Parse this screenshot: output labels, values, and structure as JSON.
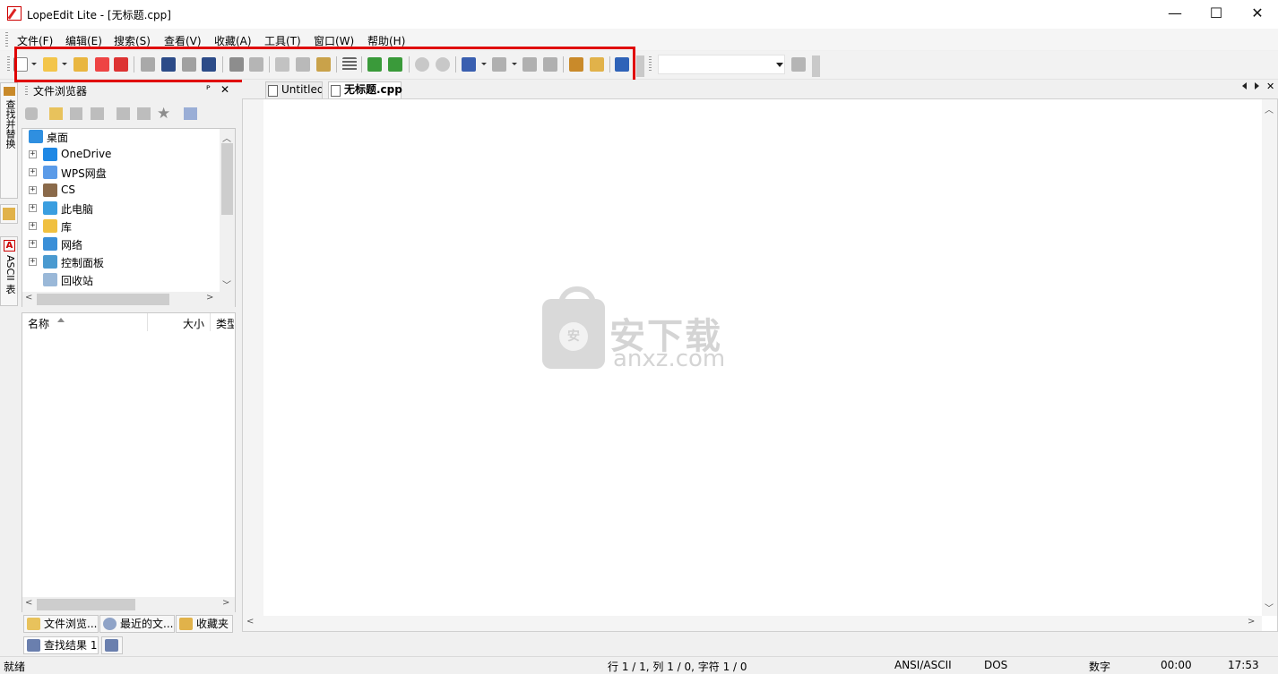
{
  "window": {
    "title": "LopeEdit Lite - [无标题.cpp]",
    "minimize_glyph": "—",
    "maximize_glyph": "☐",
    "close_glyph": "✕"
  },
  "menu": [
    "文件(F)",
    "编辑(E)",
    "搜索(S)",
    "查看(V)",
    "收藏(A)",
    "工具(T)",
    "窗口(W)",
    "帮助(H)"
  ],
  "toolbar": {
    "buttons": [
      "new-file",
      "open-file",
      "open-folder",
      "close-file",
      "close-all",
      "save-disabled",
      "save-as",
      "save-all",
      "save-copy",
      "print",
      "print-preview",
      "cut",
      "copy",
      "paste",
      "align",
      "indent",
      "outdent",
      "undo",
      "redo",
      "find",
      "find-next",
      "find-prev",
      "replace",
      "favorite",
      "favorite-manage",
      "run"
    ],
    "highlight_color": "#e00000",
    "combo_value": ""
  },
  "side_tabs": [
    "查找并替换",
    "ASCII 表"
  ],
  "file_browser": {
    "title": "文件浏览器",
    "pin_glyph": "ᴾ",
    "close_glyph": "✕",
    "tree": [
      {
        "label": "桌面",
        "icon": "desktop-icon",
        "expand": ""
      },
      {
        "label": "OneDrive",
        "icon": "onedrive-icon",
        "expand": "+"
      },
      {
        "label": "WPS网盘",
        "icon": "cloud-icon",
        "expand": "+"
      },
      {
        "label": "CS",
        "icon": "user-icon",
        "expand": "+"
      },
      {
        "label": "此电脑",
        "icon": "computer-icon",
        "expand": "+"
      },
      {
        "label": "库",
        "icon": "library-icon",
        "expand": "+"
      },
      {
        "label": "网络",
        "icon": "network-icon",
        "expand": "+"
      },
      {
        "label": "控制面板",
        "icon": "control-panel-icon",
        "expand": "+"
      },
      {
        "label": "回收站",
        "icon": "recycle-bin-icon",
        "expand": ""
      }
    ],
    "columns": {
      "name": "名称",
      "size": "大小",
      "type": "类型"
    },
    "tabs": [
      "文件浏览...",
      "最近的文...",
      "收藏夹"
    ]
  },
  "bottom_tab": "查找结果 1",
  "editor": {
    "tabs": [
      "Untitled",
      "无标题.cpp"
    ],
    "active_tab": "无标题.cpp",
    "watermark_cn": "安下载",
    "watermark_en": "anxz.com",
    "watermark_badge": "安"
  },
  "status": {
    "ready": "就绪",
    "position": "行 1 / 1, 列 1 / 0, 字符 1 / 0",
    "encoding": "ANSI/ASCII",
    "line_endings": "DOS",
    "numlock": "数字",
    "elapsed": "00:00",
    "clock": "17:53"
  }
}
